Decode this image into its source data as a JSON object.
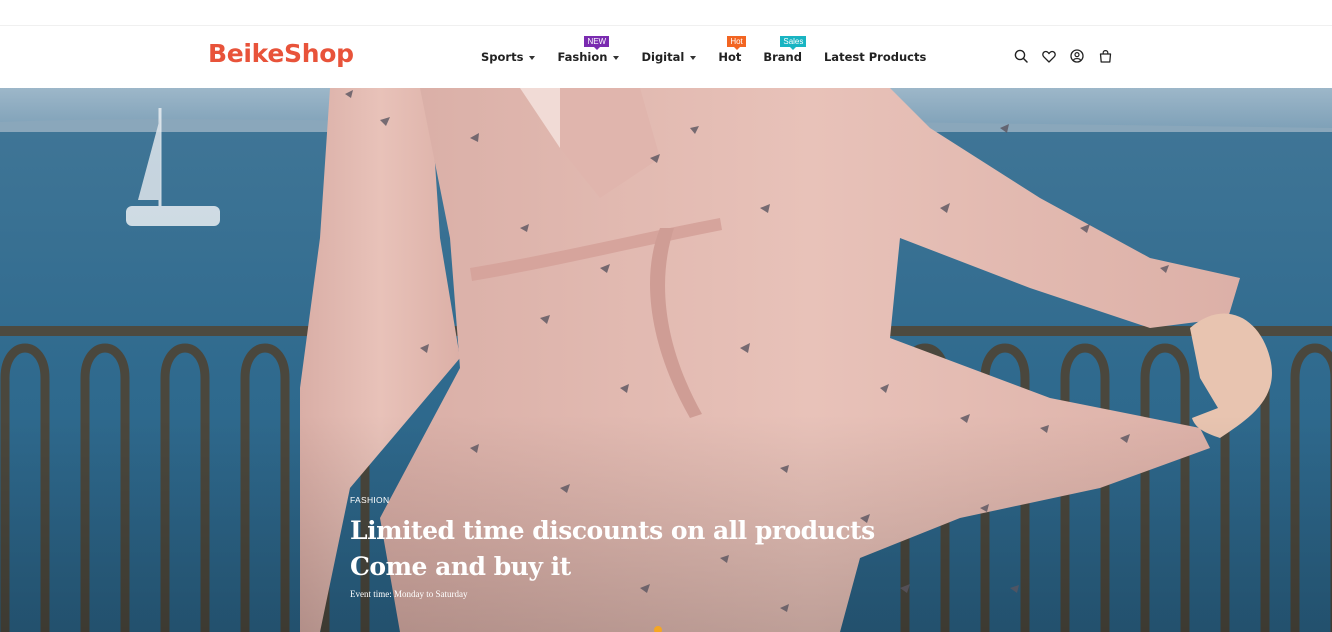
{
  "brand": {
    "logo_text": "BeikeShop",
    "accent": "#e8533a"
  },
  "nav": {
    "items": [
      {
        "label": "Sports",
        "dropdown": true
      },
      {
        "label": "Fashion",
        "dropdown": true,
        "badge": "NEW",
        "badge_color": "#7a2bb0"
      },
      {
        "label": "Digital",
        "dropdown": true
      },
      {
        "label": "Hot",
        "dropdown": false,
        "badge": "Hot",
        "badge_color": "#f26522"
      },
      {
        "label": "Brand",
        "dropdown": false,
        "badge": "Sales",
        "badge_color": "#19b4c2"
      },
      {
        "label": "Latest Products",
        "dropdown": false
      }
    ]
  },
  "header_icons": [
    "search-icon",
    "heart-icon",
    "user-icon",
    "bag-icon"
  ],
  "hero": {
    "kicker": "FASHION",
    "headline_line1": "Limited time discounts on all products",
    "headline_line2": "Come and buy it",
    "subline": "Event time: Monday to Saturday"
  },
  "slider": {
    "dot_color": "#f5a623"
  }
}
